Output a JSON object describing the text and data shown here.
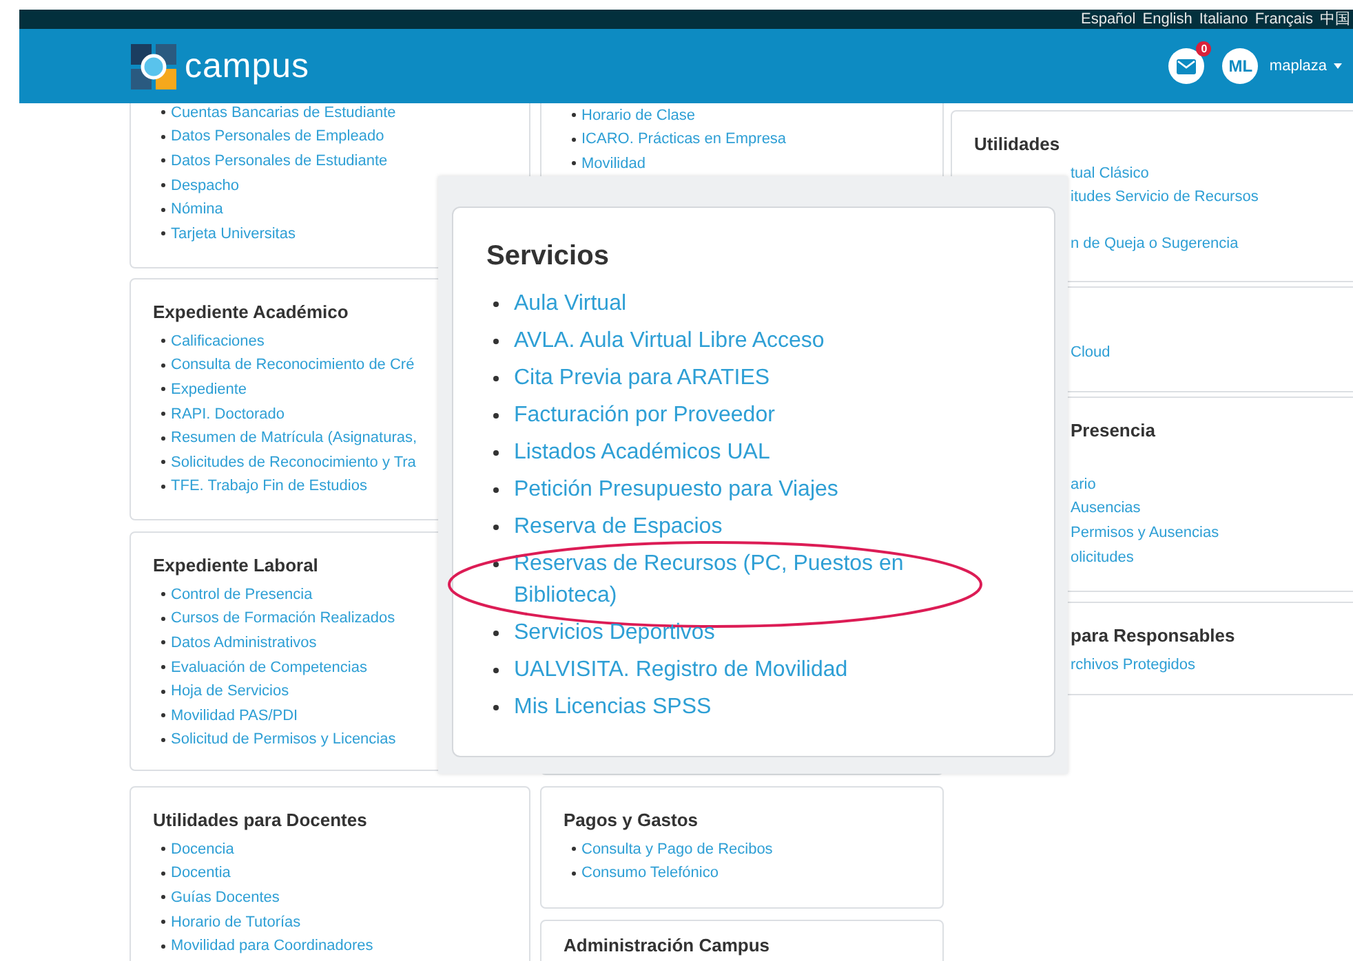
{
  "languages": [
    "Español",
    "English",
    "Italiano",
    "Français",
    "中国"
  ],
  "header": {
    "brand": "campus",
    "mail_count": "0",
    "avatar_initials": "ML",
    "username": "maplaza"
  },
  "columns": [
    [
      {
        "links": [
          "Cuentas Bancarias de Estudiante",
          "Datos Personales de Empleado",
          "Datos Personales de Estudiante",
          "Despacho",
          "Nómina",
          "Tarjeta Universitas"
        ]
      },
      {
        "title": "Expediente Académico",
        "links": [
          "Calificaciones",
          "Consulta de Reconocimiento de Cré",
          "Expediente",
          "RAPI. Doctorado",
          "Resumen de Matrícula (Asignaturas,",
          "Solicitudes de Reconocimiento y Tra",
          "TFE. Trabajo Fin de Estudios"
        ]
      },
      {
        "title": "Expediente Laboral",
        "links": [
          "Control de Presencia",
          "Cursos de Formación Realizados",
          "Datos Administrativos",
          "Evaluación de Competencias",
          "Hoja de Servicios",
          "Movilidad PAS/PDI",
          "Solicitud de Permisos y Licencias"
        ]
      },
      {
        "title": "Utilidades para Docentes",
        "links": [
          "Docencia",
          "Docentia",
          "Guías Docentes",
          "Horario de Tutorías",
          "Movilidad para Coordinadores"
        ]
      }
    ],
    [
      {
        "links": [
          "Horario de Clase",
          "ICARO. Prácticas en Empresa",
          "Movilidad"
        ]
      },
      {
        "title": "Pagos y Gastos",
        "links": [
          "Consulta y Pago de Recibos",
          "Consumo Telefónico"
        ]
      },
      {
        "title": "Administración Campus"
      }
    ],
    [
      {
        "title": "Utilidades",
        "links": [
          "tual Clásico",
          "itudes Servicio de Recursos",
          "n de Queja o Sugerencia"
        ]
      },
      {
        "links": [
          "Cloud"
        ]
      },
      {
        "title": "Presencia",
        "links": [
          "ario",
          "Ausencias",
          "Permisos y Ausencias",
          "olicitudes"
        ]
      },
      {
        "title": "para Responsables",
        "links": [
          "rchivos Protegidos"
        ]
      }
    ]
  ],
  "zoom_panel": {
    "title": "Servicios",
    "links": [
      {
        "text": "Aula Virtual",
        "circled": false
      },
      {
        "text": "AVLA. Aula Virtual Libre Acceso",
        "circled": false
      },
      {
        "text": "Cita Previa para ARATIES",
        "circled": false
      },
      {
        "text": "Facturación por Proveedor",
        "circled": false
      },
      {
        "text": "Listados Académicos UAL",
        "circled": false
      },
      {
        "text": "Petición Presupuesto para Viajes",
        "circled": false
      },
      {
        "text": "Reserva de Espacios",
        "circled": false
      },
      {
        "text": "Reservas de Recursos (PC, Puestos en Biblioteca)",
        "circled": true
      },
      {
        "text": "Servicios Deportivos",
        "circled": false
      },
      {
        "text": "UALVISITA. Registro de Movilidad",
        "circled": false
      },
      {
        "text": "Mis Licencias SPSS",
        "circled": false
      }
    ]
  }
}
